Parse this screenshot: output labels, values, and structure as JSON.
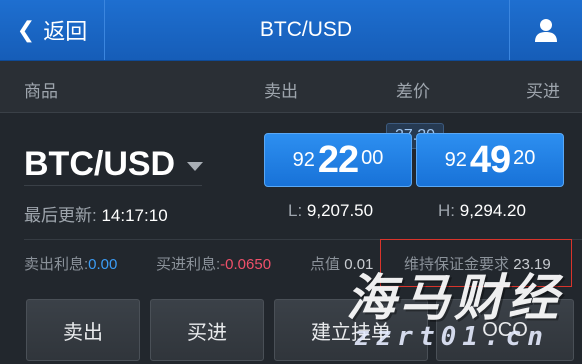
{
  "header": {
    "back_label": "返回",
    "title": "BTC/USD"
  },
  "columns": {
    "product": "商品",
    "sell": "卖出",
    "spread": "差价",
    "buy": "买进"
  },
  "quote": {
    "symbol": "BTC/USD",
    "spread": "27.20",
    "sell_price": {
      "pre": "92",
      "big": "22",
      "post": "00"
    },
    "buy_price": {
      "pre": "92",
      "big": "49",
      "post": "20"
    },
    "last_update_label": "最后更新:",
    "last_update_time": "14:17:10",
    "low_label": "L:",
    "low_value": "9,207.50",
    "high_label": "H:",
    "high_value": "9,294.20"
  },
  "details": {
    "sell_interest_label": "卖出利息:",
    "sell_interest_value": "0.00",
    "buy_interest_label": "买进利息:",
    "buy_interest_value": "-0.0650",
    "pip_value_label": "点值",
    "pip_value": "0.01",
    "margin_label": "维持保证金要求",
    "margin_value": "23.19"
  },
  "actions": {
    "sell": "卖出",
    "buy": "买进",
    "pending_order": "建立挂单",
    "oco": "OCO"
  },
  "watermark": {
    "main": "海马财经",
    "sub": "zzrt01.cn"
  },
  "colors": {
    "header_blue": "#1e6fd0",
    "price_button_blue": "#1872d8",
    "positive_blue": "#3b9cf5",
    "negative_red": "#f0506a",
    "highlight_red": "#d9342b"
  },
  "icons": {
    "back": "chevron-left-icon",
    "user": "user-icon",
    "dropdown": "caret-down-icon"
  }
}
